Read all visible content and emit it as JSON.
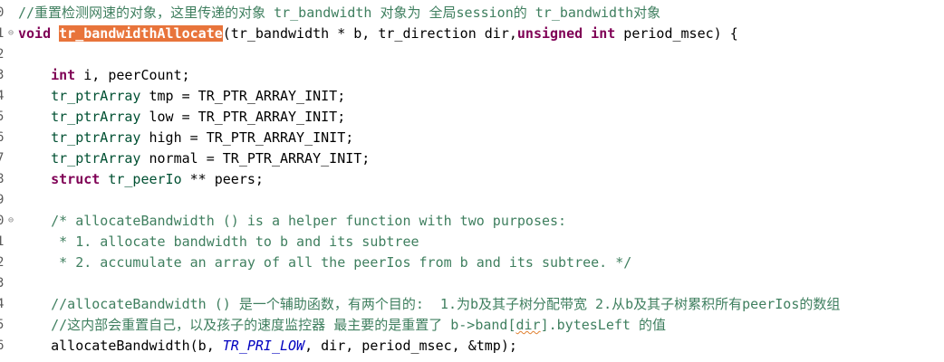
{
  "editor": {
    "lines": [
      {
        "num": "0",
        "fold": "",
        "parts": [
          {
            "text": "//重置检测网速的对象，这里传递的对象 tr_bandwidth 对象为 全局session的 tr_bandwidth对象",
            "cls": "comment"
          }
        ]
      },
      {
        "num": "1",
        "fold": "⊖",
        "parts": [
          {
            "text": "void",
            "cls": "kw"
          },
          {
            "text": " ",
            "cls": ""
          },
          {
            "text": "tr_bandwidthAllocate",
            "cls": "hl"
          },
          {
            "text": "(tr_bandwidth * b, tr_direction dir,",
            "cls": ""
          },
          {
            "text": "unsigned",
            "cls": "kw"
          },
          {
            "text": " ",
            "cls": ""
          },
          {
            "text": "int",
            "cls": "kw"
          },
          {
            "text": " period_msec) {",
            "cls": ""
          }
        ]
      },
      {
        "num": "2",
        "fold": "",
        "parts": []
      },
      {
        "num": "3",
        "fold": "",
        "parts": [
          {
            "text": "    ",
            "cls": ""
          },
          {
            "text": "int",
            "cls": "kw"
          },
          {
            "text": " i, peerCount;",
            "cls": ""
          }
        ]
      },
      {
        "num": "4",
        "fold": "",
        "parts": [
          {
            "text": "    ",
            "cls": ""
          },
          {
            "text": "tr_ptrArray",
            "cls": "type"
          },
          {
            "text": " tmp = TR_PTR_ARRAY_INIT;",
            "cls": ""
          }
        ]
      },
      {
        "num": "5",
        "fold": "",
        "parts": [
          {
            "text": "    ",
            "cls": ""
          },
          {
            "text": "tr_ptrArray",
            "cls": "type"
          },
          {
            "text": " low = TR_PTR_ARRAY_INIT;",
            "cls": ""
          }
        ]
      },
      {
        "num": "6",
        "fold": "",
        "parts": [
          {
            "text": "    ",
            "cls": ""
          },
          {
            "text": "tr_ptrArray",
            "cls": "type"
          },
          {
            "text": " high = TR_PTR_ARRAY_INIT;",
            "cls": ""
          }
        ]
      },
      {
        "num": "7",
        "fold": "",
        "parts": [
          {
            "text": "    ",
            "cls": ""
          },
          {
            "text": "tr_ptrArray",
            "cls": "type"
          },
          {
            "text": " normal = TR_PTR_ARRAY_INIT;",
            "cls": ""
          }
        ]
      },
      {
        "num": "8",
        "fold": "",
        "parts": [
          {
            "text": "    ",
            "cls": ""
          },
          {
            "text": "struct",
            "cls": "kw"
          },
          {
            "text": " ",
            "cls": ""
          },
          {
            "text": "tr_peerIo",
            "cls": "type"
          },
          {
            "text": " ** peers;",
            "cls": ""
          }
        ]
      },
      {
        "num": "9",
        "fold": "",
        "parts": []
      },
      {
        "num": "0",
        "fold": "⊖",
        "parts": [
          {
            "text": "    /* allocateBandwidth () is a helper function with two purposes:",
            "cls": "comment"
          }
        ]
      },
      {
        "num": "1",
        "fold": "",
        "parts": [
          {
            "text": "     * 1. allocate bandwidth to b and its subtree",
            "cls": "comment"
          }
        ]
      },
      {
        "num": "2",
        "fold": "",
        "parts": [
          {
            "text": "     * 2. accumulate an array of all the peerIos from b and its subtree. */",
            "cls": "comment"
          }
        ]
      },
      {
        "num": "3",
        "fold": "",
        "parts": []
      },
      {
        "num": "4",
        "fold": "",
        "parts": [
          {
            "text": "    //allocateBandwidth () 是一个辅助函数，有两个目的:  1.为b及其子树分配带宽 2.从b及其子树累积所有peerIos的数组",
            "cls": "comment"
          }
        ]
      },
      {
        "num": "5",
        "fold": "",
        "parts": [
          {
            "text": "    //这内部会重置自己，以及孩子的速度监控器 最主要的是重置了 b->band[",
            "cls": "comment"
          },
          {
            "text": "dir",
            "cls": "comment squiggle"
          },
          {
            "text": "].bytesLeft 的值",
            "cls": "comment"
          }
        ]
      },
      {
        "num": "6",
        "fold": "",
        "parts": [
          {
            "text": "    allocateBandwidth(b, ",
            "cls": ""
          },
          {
            "text": "TR_PRI_LOW",
            "cls": "macro-italic"
          },
          {
            "text": ", dir, period_msec, &tmp);",
            "cls": ""
          }
        ]
      }
    ]
  }
}
